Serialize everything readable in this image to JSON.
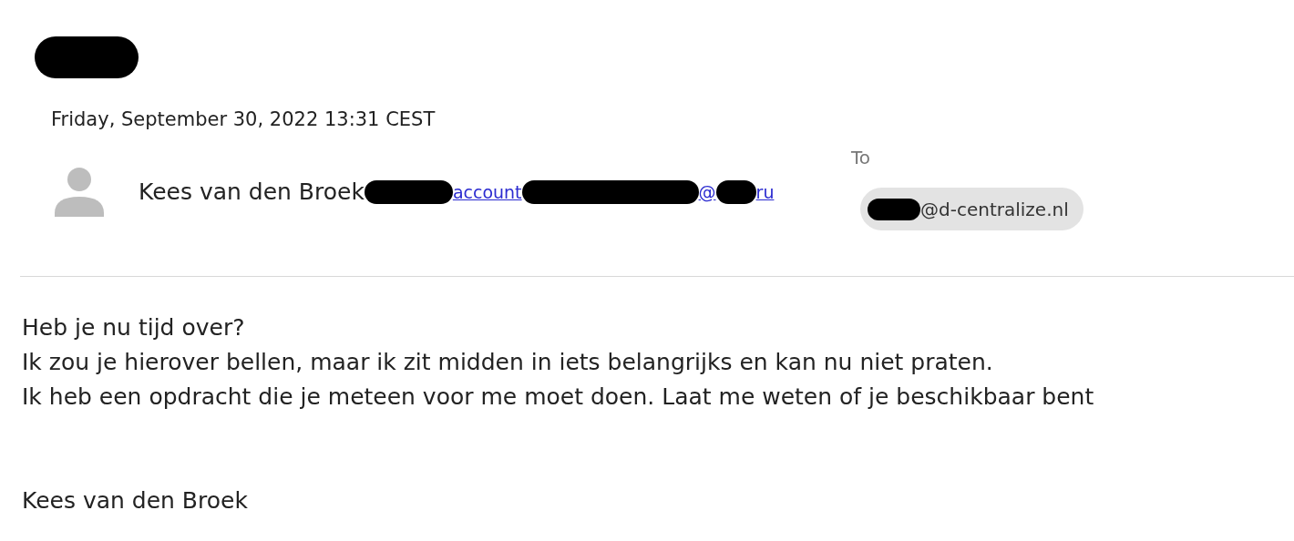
{
  "subject": {
    "redacted": true
  },
  "date": "Friday, September 30, 2022 13:31 CEST",
  "sender": {
    "name": "Kees van den Broek",
    "address_parts": [
      {
        "kind": "redacted"
      },
      {
        "kind": "text",
        "text": "account"
      },
      {
        "kind": "redacted"
      },
      {
        "kind": "text",
        "text": "@"
      },
      {
        "kind": "redacted"
      },
      {
        "kind": "text",
        "text": "ru"
      }
    ]
  },
  "to": {
    "label": "To",
    "recipients": [
      {
        "parts": [
          {
            "kind": "redacted"
          },
          {
            "kind": "text",
            "text": "@d-centralize.nl"
          }
        ]
      }
    ]
  },
  "body": [
    "Heb je nu tijd over?",
    "Ik zou je hierover bellen, maar ik zit midden in iets belangrijks en kan nu niet praten.",
    "Ik heb een opdracht die je meteen voor me moet doen. Laat me weten of je beschikbaar bent"
  ],
  "signature": "Kees van den Broek"
}
